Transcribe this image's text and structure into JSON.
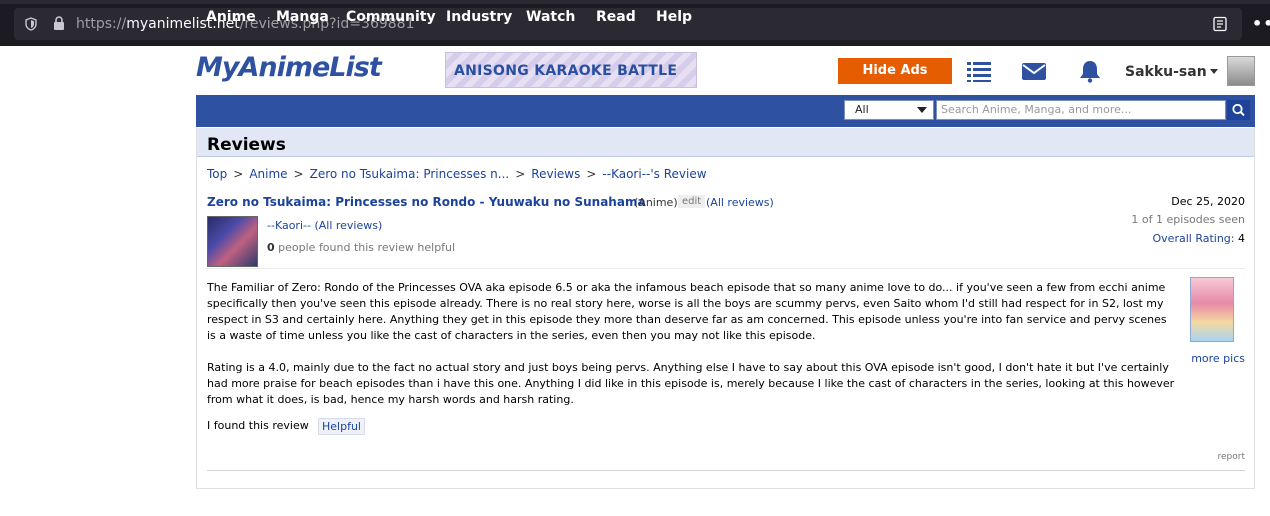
{
  "browser": {
    "url_scheme": "https://",
    "url_host": "myanimelist.net",
    "url_path": "/reviews.php?id=369881"
  },
  "header": {
    "logo": "MyAnimeList",
    "banner": "ANISONG KARAOKE BATTLE",
    "hide_ads": "Hide Ads",
    "username": "Sakku-san"
  },
  "nav": {
    "items": [
      "Anime",
      "Manga",
      "Community",
      "Industry",
      "Watch",
      "Read",
      "Help"
    ],
    "search_scope": "All",
    "search_placeholder": "Search Anime, Manga, and more..."
  },
  "page": {
    "title": "Reviews",
    "breadcrumb": [
      "Top",
      "Anime",
      "Zero no Tsukaima: Princesses n...",
      "Reviews",
      "--Kaori--'s Review"
    ]
  },
  "review": {
    "anime_title": "Zero no Tsukaima: Princesses no Rondo - Yuuwaku no Sunahama",
    "type": "(Anime)",
    "edit": "edit",
    "all_reviews_title": "(All reviews)",
    "reviewer": "--Kaori--",
    "reviewer_all_reviews": "(All reviews)",
    "helpful_count": "0",
    "helpful_text": "people found this review helpful",
    "date": "Dec 25, 2020",
    "episodes_seen": "1 of 1 episodes seen",
    "overall_rating_label": "Overall Rating:",
    "overall_rating": "4",
    "body": [
      "The Familiar of Zero: Rondo of the Princesses OVA aka episode 6.5 or aka the infamous beach episode that so many anime love to do... if you've seen a few from ecchi anime specifically then you've seen this episode already. There is no real story here, worse is all the boys are scummy pervs, even Saito whom I'd still had respect for in S2, lost my respect in S3 and certainly here. Anything they get in this episode they more than deserve far as am concerned. This episode unless you're into fan service and pervy scenes is a waste of time unless you like the cast of characters in the series, even then you may not like this episode.",
      "Rating is a 4.0, mainly due to the fact no actual story and just boys being pervs. Anything else I have to say about this OVA episode isn't good, I don't hate it but I've certainly had more praise for beach episodes than i have this one. Anything I did like in this episode is, merely because I like the cast of characters in the series, looking at this however from what it does, is bad, hence my harsh words and harsh rating."
    ],
    "more_pics": "more pics",
    "found_label": "I found this review",
    "helpful_button": "Helpful",
    "report": "report"
  }
}
